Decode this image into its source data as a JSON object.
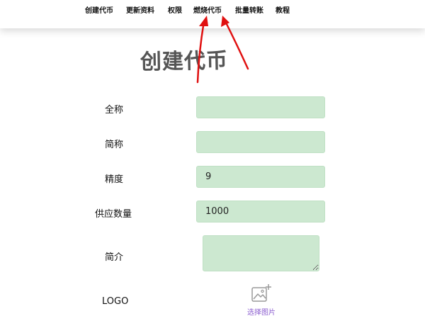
{
  "nav": {
    "items": [
      {
        "label": "创建代币"
      },
      {
        "label": "更新资料"
      },
      {
        "label": "权限"
      },
      {
        "label": "燃烧代币"
      },
      {
        "label": "批量转账"
      },
      {
        "label": "教程"
      }
    ]
  },
  "form": {
    "title": "创建代币",
    "full_name": {
      "label": "全称",
      "value": ""
    },
    "short_name": {
      "label": "简称",
      "value": ""
    },
    "precision": {
      "label": "精度",
      "value": "9"
    },
    "supply": {
      "label": "供应数量",
      "value": "1000"
    },
    "intro": {
      "label": "简介",
      "value": ""
    },
    "logo": {
      "label": "LOGO",
      "picker_label": "选择图片",
      "picker_icon": "image-add-icon"
    }
  },
  "colors": {
    "field_bg": "#cce8d0",
    "annotation_arrow": "#e01010",
    "picker_text": "#8a5ccf"
  }
}
